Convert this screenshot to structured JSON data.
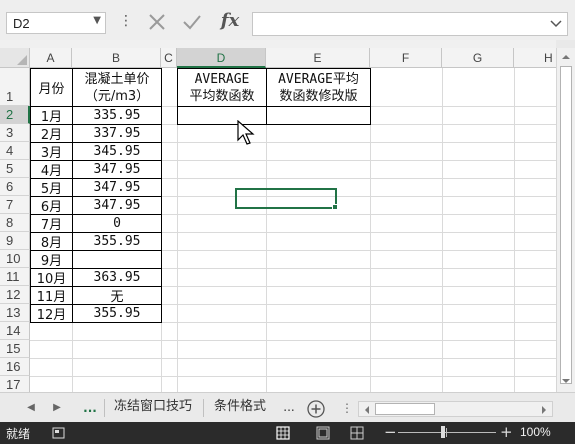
{
  "formula_bar": {
    "name_box": "D2",
    "formula": "",
    "icons": {
      "cancel": "x-cancel-icon",
      "enter": "check-enter-icon",
      "fx": "fx"
    }
  },
  "columns": [
    "A",
    "B",
    "C",
    "D",
    "E",
    "F",
    "G",
    "H"
  ],
  "selected_column": "D",
  "rows": [
    "1",
    "2",
    "3",
    "4",
    "5",
    "6",
    "7",
    "8",
    "9",
    "10",
    "11",
    "12",
    "13",
    "14",
    "15",
    "16",
    "17"
  ],
  "selected_row": "2",
  "table": {
    "header_month": "月份",
    "header_price_line1": "混凝土单价",
    "header_price_line2": "（元/m3）",
    "months": [
      "1月",
      "2月",
      "3月",
      "4月",
      "5月",
      "6月",
      "7月",
      "8月",
      "9月",
      "10月",
      "11月",
      "12月"
    ],
    "prices": [
      "335.95",
      "337.95",
      "345.95",
      "347.95",
      "347.95",
      "347.95",
      "0",
      "355.95",
      "",
      "363.95",
      "无",
      "355.95"
    ]
  },
  "result_table": {
    "d_header_line1": "AVERAGE",
    "d_header_line2": "平均数函数",
    "e_header_line1": "AVERAGE平均",
    "e_header_line2": "数函数修改版",
    "d2": "",
    "e2": ""
  },
  "sheet_tabs": {
    "more_left": "...",
    "tabs": [
      "冻结窗口技巧",
      "条件格式"
    ],
    "more_right": "..."
  },
  "status_bar": {
    "ready": "就绪",
    "zoom": "100%"
  },
  "colors": {
    "accent": "#217346",
    "status_bg": "#2b2b2b"
  }
}
